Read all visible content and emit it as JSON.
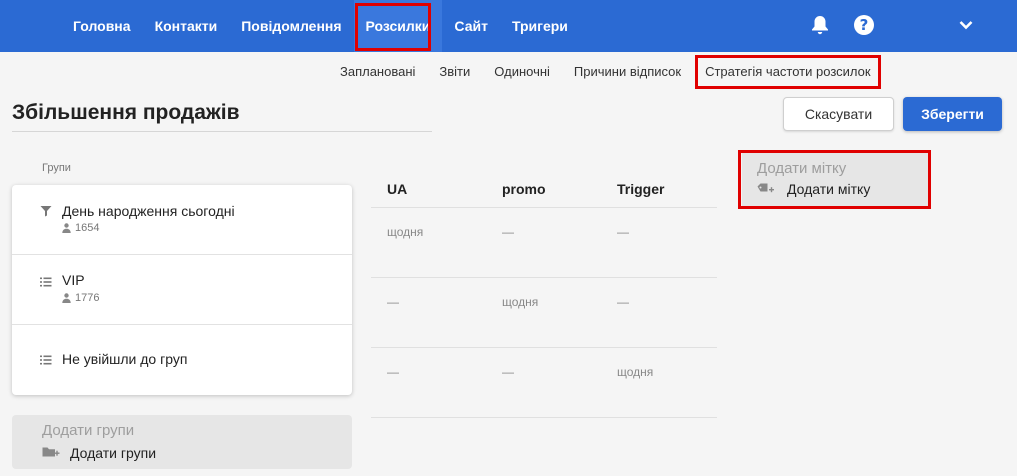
{
  "nav": {
    "items": [
      {
        "label": "Головна"
      },
      {
        "label": "Контакти"
      },
      {
        "label": "Повідомлення"
      },
      {
        "label": "Розсилки"
      },
      {
        "label": "Сайт"
      },
      {
        "label": "Тригери"
      }
    ],
    "active": "Розсилки",
    "help_symbol": "?"
  },
  "subnav": {
    "items": [
      {
        "label": "Заплановані"
      },
      {
        "label": "Звіти"
      },
      {
        "label": "Одиночні"
      },
      {
        "label": "Причини відписок"
      },
      {
        "label": "Стратегія частоти розсилок"
      }
    ],
    "highlighted": "Стратегія частоти розсилок"
  },
  "page": {
    "title": "Збільшення продажів"
  },
  "actions": {
    "cancel_label": "Скасувати",
    "save_label": "Зберегти"
  },
  "groups": {
    "label": "Групи",
    "items": [
      {
        "name": "День народження сьогодні",
        "count": "1654",
        "icon": "filter-icon"
      },
      {
        "name": "VIP",
        "count": "1776",
        "icon": "list-icon"
      },
      {
        "name": "Не увійшли до груп",
        "count": "",
        "icon": "list-icon"
      }
    ],
    "add_hint": "Додати групи",
    "add_label": "Додати групи"
  },
  "matrix": {
    "columns": [
      "UA",
      "promo",
      "Trigger"
    ],
    "rows": [
      [
        "щодня",
        "—",
        "—"
      ],
      [
        "—",
        "щодня",
        "—"
      ],
      [
        "—",
        "—",
        "щодня"
      ]
    ]
  },
  "tags": {
    "hint": "Додати мітку",
    "add_label": "Додати мітку"
  },
  "colors": {
    "primary": "#2b6ad3",
    "highlight": "#e00000",
    "background": "#f5f5f5"
  }
}
